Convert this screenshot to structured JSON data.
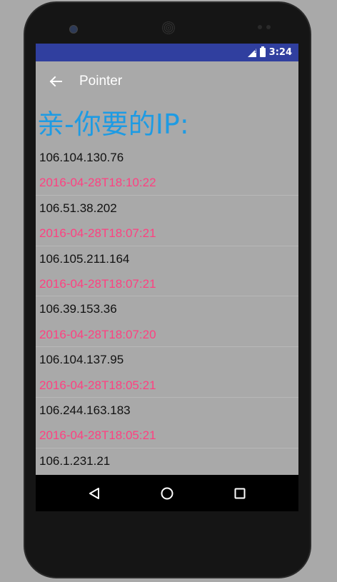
{
  "status_bar": {
    "time": "3:24",
    "background": "#303f9f"
  },
  "app_bar": {
    "title": "Pointer",
    "back_icon": "arrow-back-icon"
  },
  "heading": {
    "text": "亲-你要的IP:",
    "color": "#1e9be3"
  },
  "entries": [
    {
      "ip": "106.104.130.76",
      "time": "2016-04-28T18:10:22"
    },
    {
      "ip": "106.51.38.202",
      "time": "2016-04-28T18:07:21"
    },
    {
      "ip": "106.105.211.164",
      "time": "2016-04-28T18:07:21"
    },
    {
      "ip": "106.39.153.36",
      "time": "2016-04-28T18:07:20"
    },
    {
      "ip": "106.104.137.95",
      "time": "2016-04-28T18:05:21"
    },
    {
      "ip": "106.244.163.183",
      "time": "2016-04-28T18:05:21"
    },
    {
      "ip": "106.1.231.21",
      "time": ""
    }
  ],
  "colors": {
    "ip_text": "#111111",
    "time_text": "#ff4081",
    "screen_bg": "#a9a9a9"
  },
  "nav_bar": {
    "back": "back-triangle-icon",
    "home": "home-circle-icon",
    "recents": "recents-square-icon"
  }
}
